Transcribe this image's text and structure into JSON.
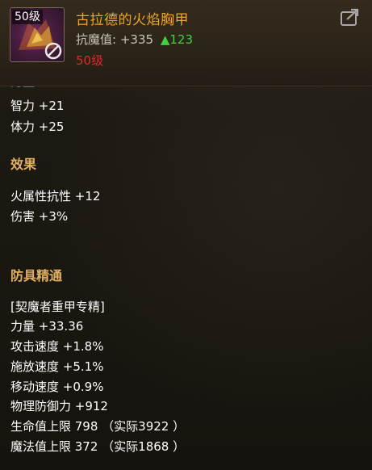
{
  "item": {
    "level_badge": "50级",
    "name": "古拉德的火焰胸甲",
    "resist_label": "抗魔值:",
    "resist_value": "+335",
    "resist_increase": "▲123",
    "required_level": "50级",
    "icon": "flame-chestplate-icon",
    "restriction_icon": "no-symbol-icon",
    "share_icon": "share-export-icon"
  },
  "base_stats": [
    "智力 +21",
    "体力 +25"
  ],
  "effects": {
    "title": "效果",
    "lines": [
      "火属性抗性 +12",
      "伤害 +3%"
    ]
  },
  "mastery": {
    "title": "防具精通",
    "subtitle": "[契魔者重甲专精]",
    "lines": [
      "力量 +33.36",
      "攻击速度 +1.8%",
      "施放速度 +5.1%",
      "移动速度 +0.9%",
      "物理防御力 +912",
      "生命值上限 798 （实际3922 ）",
      "魔法值上限 372 （实际1868 ）"
    ]
  },
  "colors": {
    "item_name": "#f0a622",
    "increase": "#3fd23f",
    "required_level": "#e02a2a",
    "section_title": "#e0b060",
    "text": "#ffffff"
  }
}
